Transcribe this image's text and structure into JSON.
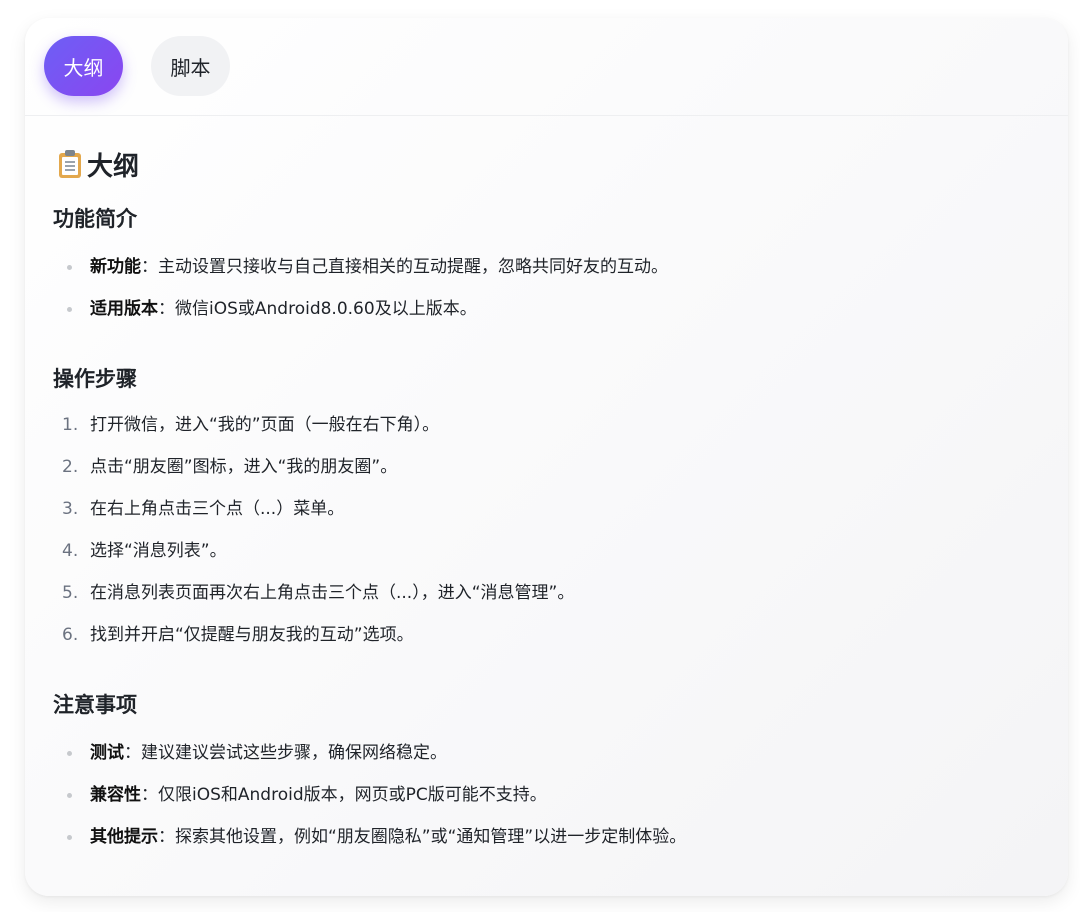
{
  "tabs": [
    {
      "label": "大纲",
      "active": true
    },
    {
      "label": "脚本",
      "active": false
    }
  ],
  "doc": {
    "title": "大纲",
    "title_icon": "clipboard-icon",
    "sections": [
      {
        "heading": "功能简介",
        "type": "bullet",
        "items": [
          {
            "term": "新功能",
            "text": "：主动设置只接收与自己直接相关的互动提醒，忽略共同好友的互动。"
          },
          {
            "term": "适用版本",
            "text": "：微信iOS或Android8.0.60及以上版本。"
          }
        ]
      },
      {
        "heading": "操作步骤",
        "type": "numbered",
        "items": [
          {
            "num": "1.",
            "text": "打开微信，进入“我的”页面（一般在右下角）。"
          },
          {
            "num": "2.",
            "text": "点击“朋友圈”图标，进入“我的朋友圈”。"
          },
          {
            "num": "3.",
            "text": "在右上角点击三个点（...）菜单。"
          },
          {
            "num": "4.",
            "text": "选择“消息列表”。"
          },
          {
            "num": "5.",
            "text": "在消息列表页面再次右上角点击三个点（...），进入“消息管理”。"
          },
          {
            "num": "6.",
            "text": "找到并开启“仅提醒与朋友我的互动”选项。"
          }
        ]
      },
      {
        "heading": "注意事项",
        "type": "bullet",
        "items": [
          {
            "term": "测试",
            "text": "：建议建议尝试这些步骤，确保网络稳定。"
          },
          {
            "term": "兼容性",
            "text": "：仅限iOS和Android版本，网页或PC版可能不支持。"
          },
          {
            "term": "其他提示",
            "text": "：探索其他设置，例如“朋友圈隐私”或“通知管理”以进一步定制体验。"
          }
        ]
      }
    ]
  },
  "colors": {
    "accent_start": "#6d5ff5",
    "accent_end": "#8a46f0"
  }
}
